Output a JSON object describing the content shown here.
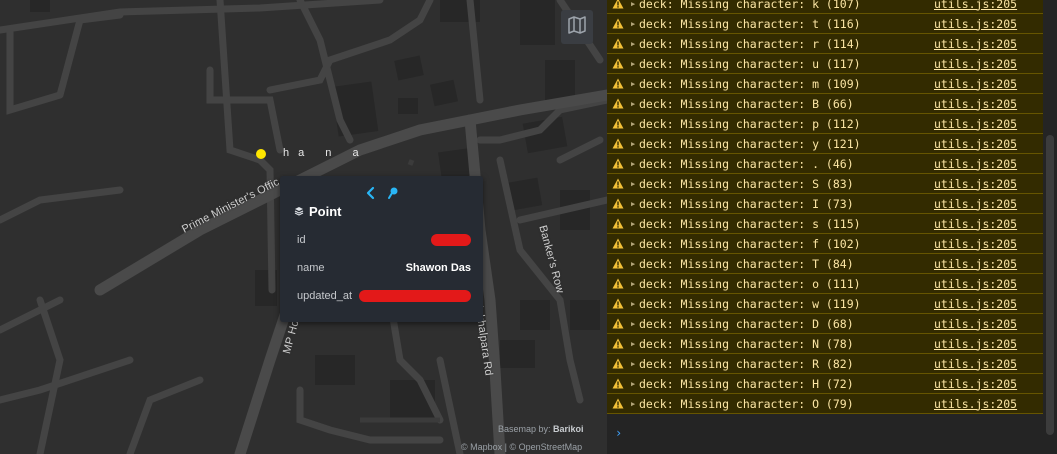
{
  "map": {
    "road_labels": {
      "prime_ministers_office": "Prime Minister's Offic",
      "bankers_row": "Banker's Row",
      "nakhalpara_rd": "W Nakhalpara Rd",
      "mp_ho": "MP Ho"
    },
    "point_label": "ha n a",
    "popup": {
      "title": "Point",
      "rows": [
        {
          "key": "id",
          "value": ""
        },
        {
          "key": "name",
          "value": "Shawon Das"
        },
        {
          "key": "updated_at",
          "value": ""
        }
      ]
    },
    "attribution": {
      "basemap_prefix": "Basemap by:",
      "basemap_name": "Barikoi",
      "credits": "© Mapbox | © OpenStreetMap"
    },
    "colors": {
      "point": "#ffe600",
      "accent": "#29b6f6",
      "redaction": "#e31919"
    }
  },
  "console": {
    "messages": [
      {
        "text": "deck: Missing character: k (107)",
        "source": "utils.js:205"
      },
      {
        "text": "deck: Missing character: t (116)",
        "source": "utils.js:205"
      },
      {
        "text": "deck: Missing character: r (114)",
        "source": "utils.js:205"
      },
      {
        "text": "deck: Missing character: u (117)",
        "source": "utils.js:205"
      },
      {
        "text": "deck: Missing character: m (109)",
        "source": "utils.js:205"
      },
      {
        "text": "deck: Missing character: B (66)",
        "source": "utils.js:205"
      },
      {
        "text": "deck: Missing character: p (112)",
        "source": "utils.js:205"
      },
      {
        "text": "deck: Missing character: y (121)",
        "source": "utils.js:205"
      },
      {
        "text": "deck: Missing character: . (46)",
        "source": "utils.js:205"
      },
      {
        "text": "deck: Missing character: S (83)",
        "source": "utils.js:205"
      },
      {
        "text": "deck: Missing character: I (73)",
        "source": "utils.js:205"
      },
      {
        "text": "deck: Missing character: s (115)",
        "source": "utils.js:205"
      },
      {
        "text": "deck: Missing character: f (102)",
        "source": "utils.js:205"
      },
      {
        "text": "deck: Missing character: T (84)",
        "source": "utils.js:205"
      },
      {
        "text": "deck: Missing character: o (111)",
        "source": "utils.js:205"
      },
      {
        "text": "deck: Missing character: w (119)",
        "source": "utils.js:205"
      },
      {
        "text": "deck: Missing character: D (68)",
        "source": "utils.js:205"
      },
      {
        "text": "deck: Missing character: N (78)",
        "source": "utils.js:205"
      },
      {
        "text": "deck: Missing character: R (82)",
        "source": "utils.js:205"
      },
      {
        "text": "deck: Missing character: H (72)",
        "source": "utils.js:205"
      },
      {
        "text": "deck: Missing character: O (79)",
        "source": "utils.js:205"
      }
    ],
    "prompt_symbol": "›",
    "colors": {
      "warning_bg": "#332b00",
      "warning_text": "#fce6a4",
      "prompt": "#3ea3ff"
    }
  }
}
